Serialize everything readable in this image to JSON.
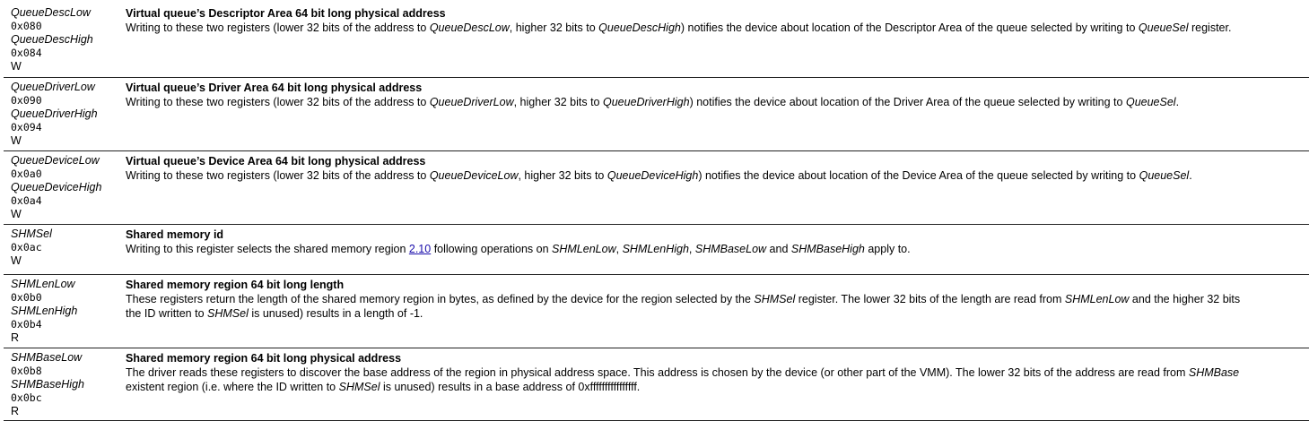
{
  "rows": [
    {
      "names": [
        "QueueDescLow",
        "QueueDescHigh"
      ],
      "offsets": [
        "0x080",
        "0x084"
      ],
      "access": "W",
      "title": "Virtual queue’s Descriptor Area 64 bit long physical address",
      "desc": {
        "p1": "Writing to these two registers (lower 32 bits of the address to ",
        "e1": "QueueDescLow",
        "p2": ", higher 32 bits to ",
        "e2": "QueueDescHigh",
        "p3": ") notifies the device about location of the Descriptor Area of the queue selected by writing to ",
        "e3": "QueueSel",
        "p4": " register."
      }
    },
    {
      "names": [
        "QueueDriverLow",
        "QueueDriverHigh"
      ],
      "offsets": [
        "0x090",
        "0x094"
      ],
      "access": "W",
      "title": "Virtual queue’s Driver Area 64 bit long physical address",
      "desc": {
        "p1": "Writing to these two registers (lower 32 bits of the address to ",
        "e1": "QueueDriverLow",
        "p2": ", higher 32 bits to ",
        "e2": "QueueDriverHigh",
        "p3": ") notifies the device about location of the Driver Area of the queue selected by writing to ",
        "e3": "QueueSel",
        "p4": "."
      }
    },
    {
      "names": [
        "QueueDeviceLow",
        "QueueDeviceHigh"
      ],
      "offsets": [
        "0x0a0",
        "0x0a4"
      ],
      "access": "W",
      "title": "Virtual queue’s Device Area 64 bit long physical address",
      "desc": {
        "p1": "Writing to these two registers (lower 32 bits of the address to ",
        "e1": "QueueDeviceLow",
        "p2": ", higher 32 bits to ",
        "e2": "QueueDeviceHigh",
        "p3": ") notifies the device about location of the Device Area of the queue selected by writing to ",
        "e3": "QueueSel",
        "p4": "."
      }
    },
    {
      "names": [
        "SHMSel"
      ],
      "offsets": [
        "0x0ac"
      ],
      "access": "W",
      "title": "Shared memory id",
      "desc": {
        "p1": "Writing to this register selects the shared memory region ",
        "link": "2.10",
        "p2": " following operations on ",
        "e1": "SHMLenLow",
        "p3": ", ",
        "e2": "SHMLenHigh",
        "p4": ", ",
        "e3": "SHMBaseLow",
        "p5": " and ",
        "e4": "SHMBaseHigh",
        "p6": " apply to."
      }
    },
    {
      "names": [
        "SHMLenLow",
        "SHMLenHigh"
      ],
      "offsets": [
        "0x0b0",
        "0x0b4"
      ],
      "access": "R",
      "title": "Shared memory region 64 bit long length",
      "line1": {
        "p1": "These registers return the length of the shared memory region in bytes, as defined by the device for the region selected by the ",
        "e1": "SHMSel",
        "p2": " register. The lower 32 bits of the length are read from ",
        "e2": "SHMLenLow",
        "p3": " and the higher 32 bits"
      },
      "line2": {
        "p1": "the ID written to ",
        "e1": "SHMSel",
        "p2": " is unused) results in a length of -1."
      }
    },
    {
      "names": [
        "SHMBaseLow",
        "SHMBaseHigh"
      ],
      "offsets": [
        "0x0b8",
        "0x0bc"
      ],
      "access": "R",
      "title": "Shared memory region 64 bit long physical address",
      "line1": {
        "p1": "The driver reads these registers to discover the base address of the region in physical address space. This address is chosen by the device (or other part of the VMM). The lower 32 bits of the address are read from ",
        "e1": "SHMBase"
      },
      "line2": {
        "p1": "existent region (i.e. where the ID written to ",
        "e1": "SHMSel",
        "p2": " is unused) results in a base address of 0xffffffffffffffff."
      }
    }
  ]
}
